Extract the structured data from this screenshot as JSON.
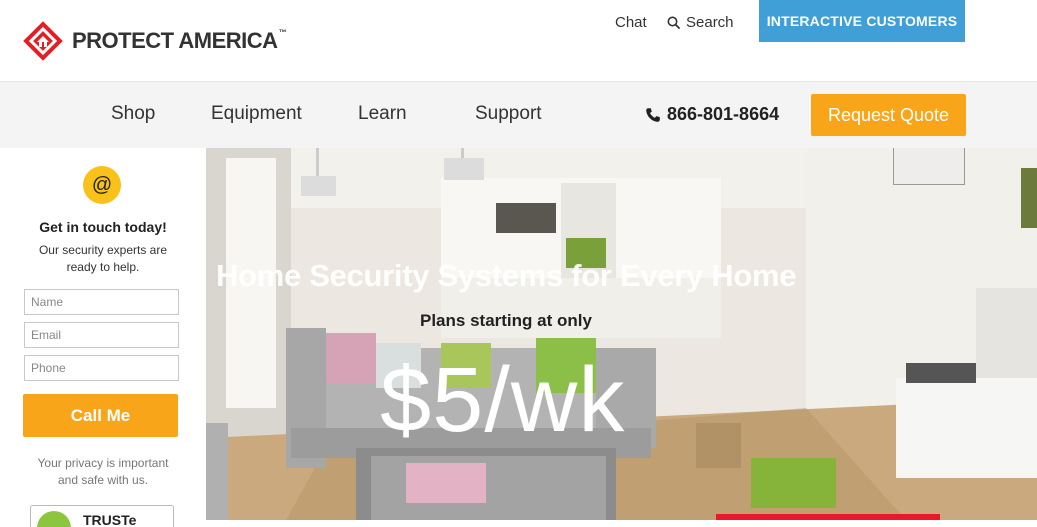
{
  "brand": {
    "name": "PROTECT AMERICA",
    "tm": "™",
    "logo_color": "#e31e24"
  },
  "topbar": {
    "chat_label": "Chat",
    "search_label": "Search",
    "interactive_label": "INTERACTIVE CUSTOMERS",
    "interactive_color": "#3f9fd6"
  },
  "nav": {
    "items": [
      {
        "label": "Shop"
      },
      {
        "label": "Equipment"
      },
      {
        "label": "Learn"
      },
      {
        "label": "Support"
      }
    ],
    "phone": "866-801-8664",
    "quote_label": "Request Quote",
    "accent": "#f9a51a"
  },
  "sidebar": {
    "icon": "at-icon",
    "heading": "Get in touch today!",
    "subtext": "Our security experts are ready to help.",
    "name_placeholder": "Name",
    "email_placeholder": "Email",
    "phone_placeholder": "Phone",
    "call_label": "Call Me",
    "privacy": "Your privacy is important and safe with us.",
    "trust_label": "TRUSTe"
  },
  "hero": {
    "title": "Home Security Systems for Every Home",
    "subtitle": "Plans starting at only",
    "price": "$5/wk"
  }
}
